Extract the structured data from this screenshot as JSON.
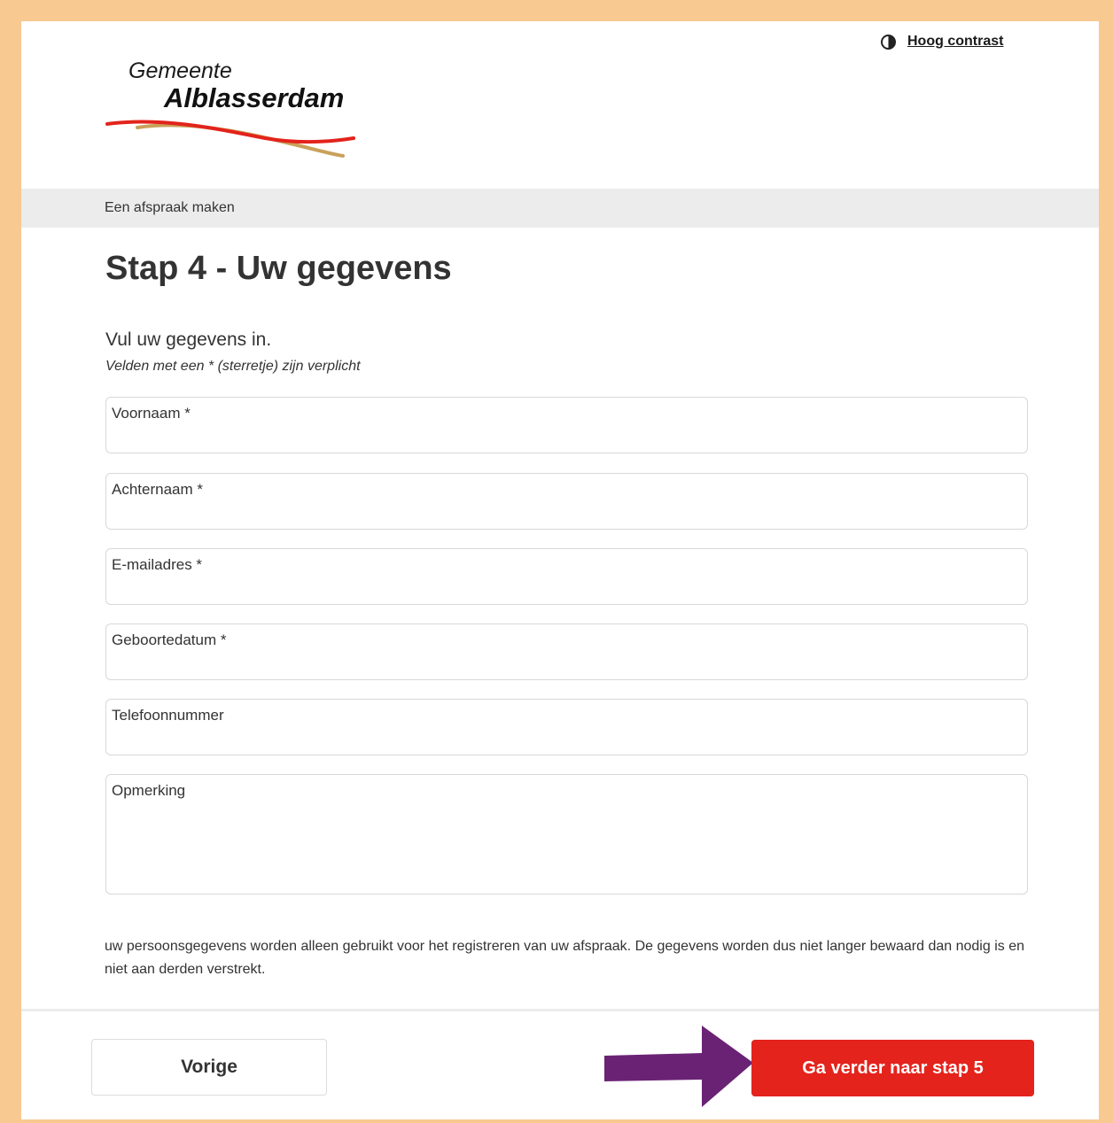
{
  "header": {
    "contrast_icon": "half-circle-contrast-icon",
    "high_contrast_label": "Hoog contrast",
    "logo": {
      "line1": "Gemeente",
      "line2": "Alblasserdam"
    }
  },
  "breadcrumb": "Een afspraak maken",
  "main": {
    "title": "Stap 4 - Uw gegevens",
    "intro": "Vul uw gegevens in.",
    "required_note": "Velden met een * (sterretje) zijn verplicht",
    "fields": [
      {
        "label": "Voornaam *",
        "value": ""
      },
      {
        "label": "Achternaam *",
        "value": ""
      },
      {
        "label": "E-mailadres *",
        "value": ""
      },
      {
        "label": "Geboortedatum *",
        "value": ""
      },
      {
        "label": "Telefoonnummer",
        "value": ""
      },
      {
        "label": "Opmerking",
        "value": ""
      }
    ],
    "privacy_text": "uw persoonsgegevens worden alleen gebruikt voor het registreren van uw afspraak. De gegevens worden dus niet langer bewaard dan nodig is en niet aan derden verstrekt."
  },
  "footer": {
    "prev_label": "Vorige",
    "next_label": "Ga verder naar stap 5"
  },
  "colors": {
    "frame": "#f8c991",
    "primary_button": "#e3231c",
    "arrow": "#6a2374",
    "logo_red": "#e3231c",
    "logo_gold": "#c9a15a"
  }
}
